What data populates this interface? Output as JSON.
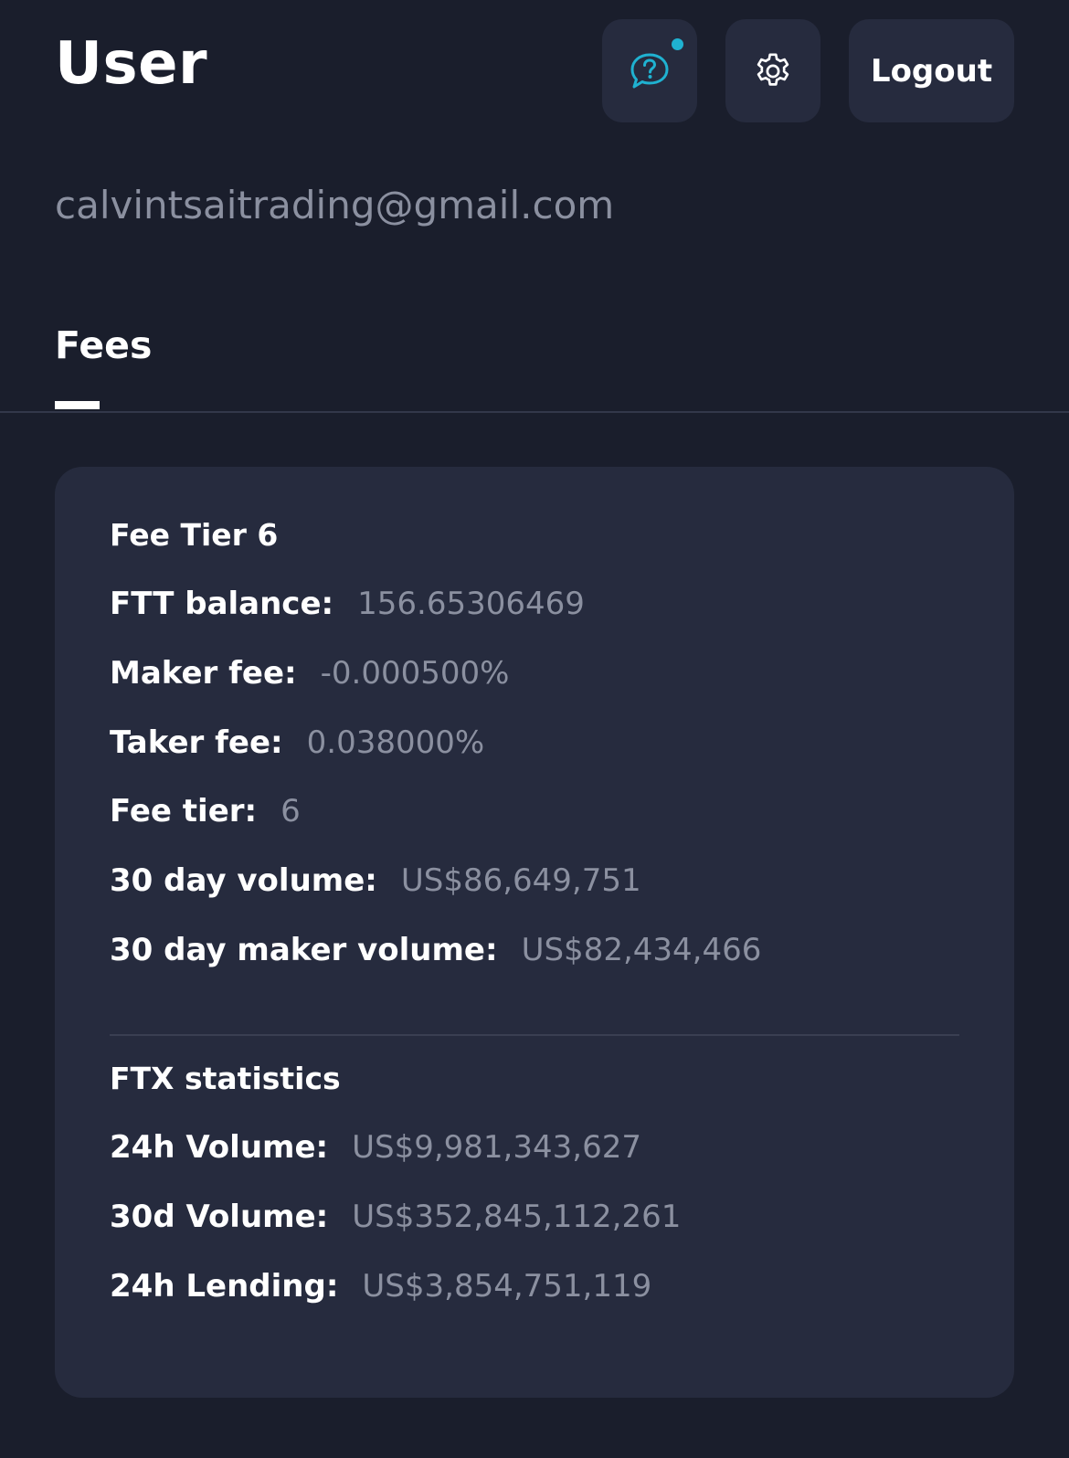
{
  "header": {
    "title": "User",
    "logout_label": "Logout",
    "help_icon": "help-chat-icon",
    "settings_icon": "gear-icon",
    "notification_dot_color": "#1fb2d1"
  },
  "email": "calvintsaitrading@gmail.com",
  "tabs": [
    {
      "label": "Fees",
      "active": true
    }
  ],
  "fees_card": {
    "tier_title": "Fee Tier 6",
    "rows": [
      {
        "label": "FTT balance:",
        "value": "156.65306469"
      },
      {
        "label": "Maker fee:",
        "value": "-0.000500%"
      },
      {
        "label": "Taker fee:",
        "value": "0.038000%"
      },
      {
        "label": "Fee tier:",
        "value": "6"
      },
      {
        "label": "30 day volume:",
        "value": "US$86,649,751"
      },
      {
        "label": "30 day maker volume:",
        "value": "US$82,434,466"
      }
    ],
    "stats_title": "FTX statistics",
    "stats": [
      {
        "label": "24h Volume:",
        "value": "US$9,981,343,627"
      },
      {
        "label": "30d Volume:",
        "value": "US$352,845,112,261"
      },
      {
        "label": "24h Lending:",
        "value": "US$3,854,751,119"
      }
    ]
  },
  "colors": {
    "background": "#1a1e2c",
    "card": "#262b3e",
    "muted_text": "#8b90a0",
    "accent": "#1fb2d1"
  }
}
